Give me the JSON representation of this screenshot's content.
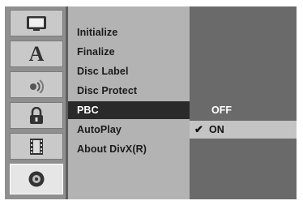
{
  "icons": [
    {
      "name": "tv-icon"
    },
    {
      "name": "language-icon",
      "glyph": "A"
    },
    {
      "name": "audio-speaker-icon"
    },
    {
      "name": "lock-icon"
    },
    {
      "name": "film-strip-icon"
    },
    {
      "name": "disc-icon"
    }
  ],
  "menu": {
    "items": [
      {
        "label": "Initialize"
      },
      {
        "label": "Finalize"
      },
      {
        "label": "Disc Label"
      },
      {
        "label": "Disc Protect"
      },
      {
        "label": "PBC"
      },
      {
        "label": "AutoPlay"
      },
      {
        "label": "About DivX(R)"
      }
    ],
    "selected_index": 4
  },
  "options": {
    "off_label": "OFF",
    "on_label": "ON",
    "check_mark": "✔"
  },
  "colors": {
    "selected_menu_bg": "#2a2a2a",
    "selected_option_bg": "#c4c4c4"
  }
}
